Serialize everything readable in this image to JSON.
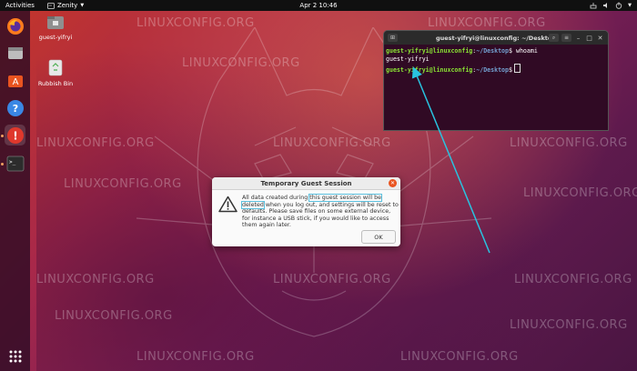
{
  "topbar": {
    "activities": "Activities",
    "app_name": "Zenity",
    "clock": "Apr 2  10:46"
  },
  "desktop": {
    "icons": [
      {
        "label": "guest-yifryi",
        "icon": "home-folder-icon"
      },
      {
        "label": "Rubbish Bin",
        "icon": "trash-icon"
      }
    ]
  },
  "dock": {
    "apps": [
      "firefox-icon",
      "files-icon",
      "software-icon",
      "help-icon",
      "error-report-icon",
      "terminal-icon"
    ],
    "show_apps": "show-applications-icon"
  },
  "terminal": {
    "title": "guest-yifryi@linuxconfig: ~/Desktop",
    "lines": [
      {
        "user": "guest-yifryi@linuxconfig",
        "path": "~/Desktop",
        "symbol": "$",
        "command": "whoami"
      },
      {
        "output": "guest-yifryi"
      },
      {
        "user": "guest-yifryi@linuxconfig",
        "path": "~/Desktop",
        "symbol": "$",
        "command": ""
      }
    ]
  },
  "dialog": {
    "title": "Temporary Guest Session",
    "message_prefix": "All data created during ",
    "message_highlight": "this guest session will be deleted",
    "message_suffix": " when you log out, and settings will be reset to defaults. Please save files on some external device, for instance a USB stick, if you would like to access them again later.",
    "ok_label": "OK"
  },
  "watermark": "LINUXCONFIG.ORG",
  "colors": {
    "accent": "#e95420",
    "highlight": "#5bc0de",
    "arrow": "#29c3e0",
    "terminal_bg": "#300a24",
    "prompt_user": "#8ae234",
    "prompt_path": "#729fcf"
  }
}
